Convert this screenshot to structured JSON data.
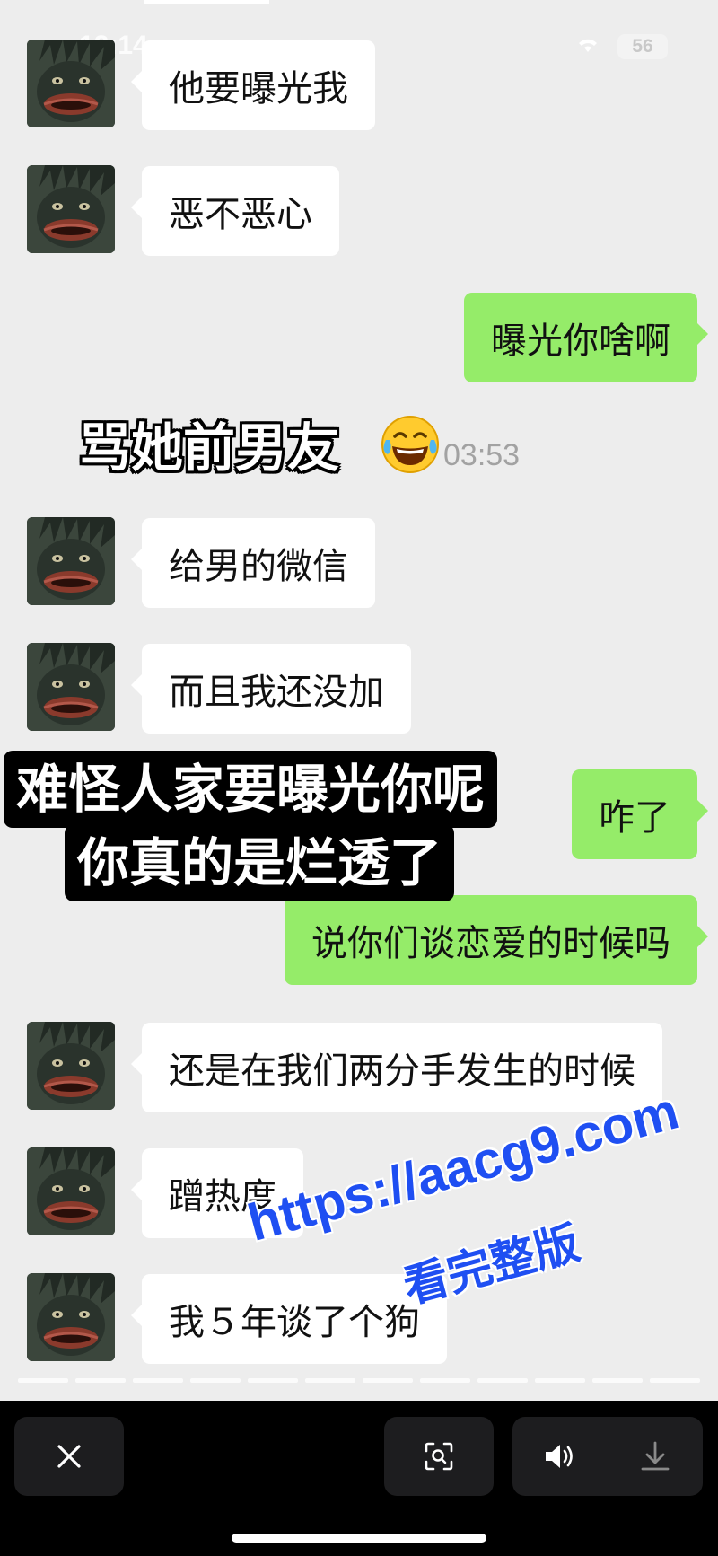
{
  "status_bar": {
    "time": "12:14",
    "battery": "56",
    "icons": [
      "wifi-icon",
      "battery-icon"
    ]
  },
  "messages": [
    {
      "side": "left",
      "text": "他要曝光我"
    },
    {
      "side": "left",
      "text": "恶不恶心"
    },
    {
      "side": "right",
      "text": "曝光你啥啊"
    },
    {
      "side": "left",
      "text": "给男的微信"
    },
    {
      "side": "left",
      "text": "而且我还没加"
    },
    {
      "side": "right",
      "text": "咋了"
    },
    {
      "side": "right",
      "text": "说你们谈恋爱的时候吗"
    },
    {
      "side": "left",
      "text": "还是在我们两分手发生的时候"
    },
    {
      "side": "left",
      "text": "蹭热度"
    },
    {
      "side": "left",
      "text": "我５年谈了个狗"
    }
  ],
  "annotations": {
    "caption1": "骂她前男友",
    "caption1_emoji": "laughing-tears-icon",
    "timestamp": "03:53",
    "overlay_line1": "难怪人家要曝光你呢",
    "overlay_line2": "你真的是烂透了"
  },
  "watermark": {
    "url": "https://aacg9.com",
    "sub": "看完整版",
    "color": "#1f4ff2"
  },
  "bottom_bar": {
    "icons": [
      "close-icon",
      "scan-icon",
      "speaker-icon",
      "download-icon"
    ]
  },
  "colors": {
    "chat_background": "#ededed",
    "left_bubble": "#ffffff",
    "right_bubble": "#95ec69",
    "bottom_bar": "#000000"
  },
  "story_progress_segments": 12
}
